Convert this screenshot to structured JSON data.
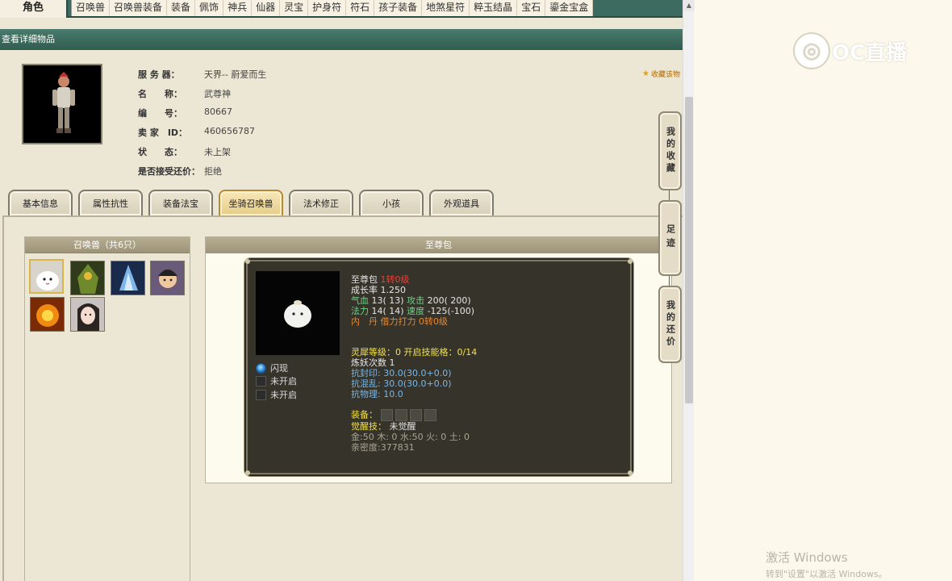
{
  "top_tabs": {
    "active": "角色",
    "items": [
      "召唤兽",
      "召唤兽装备",
      "装备",
      "佩饰",
      "神兵",
      "仙器",
      "灵宝",
      "护身符",
      "符石",
      "孩子装备",
      "地煞星符",
      "粹玉结晶",
      "宝石",
      "鎏金宝盒"
    ]
  },
  "page_title": "查看详细物品",
  "seller_info": {
    "rows": [
      {
        "label": "服 务 器：",
        "value": "天界-- 蔚爱而生"
      },
      {
        "label": "名　　称：",
        "value": "武尊神"
      },
      {
        "label": "编　　号：",
        "value": "80667"
      },
      {
        "label": "卖 家　ID：",
        "value": "460656787"
      },
      {
        "label": "状　　态：",
        "value": "未上架"
      },
      {
        "label": "是否接受还价：",
        "value": "拒绝"
      }
    ],
    "fav_link": "收藏该物"
  },
  "section_tabs": [
    "基本信息",
    "属性抗性",
    "装备法宝",
    "坐骑召唤兽",
    "法术修正",
    "小孩",
    "外观道具"
  ],
  "active_section": "坐骑召唤兽",
  "pet_list": {
    "header": "召唤兽（共6只）",
    "pets": [
      "至尊包",
      "pet-2",
      "pet-3",
      "pet-4",
      "pet-5",
      "pet-6"
    ]
  },
  "detail": {
    "header": "至尊包",
    "name": "至尊包",
    "level": "1转0级",
    "growth": "成长率 1.250",
    "hp_label": "气血 ",
    "hp_value": "13( 13)",
    "atk_label": " 攻击 ",
    "atk_value": "200( 200)",
    "mp_label": "法力 ",
    "mp_value": "14( 14)",
    "spd_label": " 速度 ",
    "spd_value": "-125(-100)",
    "core_line": "内　丹 借力打力 0转0级",
    "spirit_line": "灵犀等级：0 开启技能格：0/14",
    "refine_line": "炼妖次数 1",
    "resist_seal": "抗封印: 30.0(30.0+0.0)",
    "resist_chaos": "抗混乱: 30.0(30.0+0.0)",
    "resist_phys": "抗物理: 10.0",
    "equip_label": "装备：",
    "awaken_label": "觉醒技：",
    "awaken_value": "未觉醒",
    "elements": "金:50 木: 0 水:50 火: 0 土: 0",
    "intimacy": "亲密度:377831",
    "skills": [
      "闪现",
      "未开启",
      "未开启"
    ]
  },
  "float_buttons": [
    "我的收藏",
    "足迹",
    "我的还价"
  ],
  "watermark": {
    "logo": "OC直播",
    "activate": "激活 Windows",
    "activate_sub": "转到\"设置\"以激活 Windows。"
  }
}
